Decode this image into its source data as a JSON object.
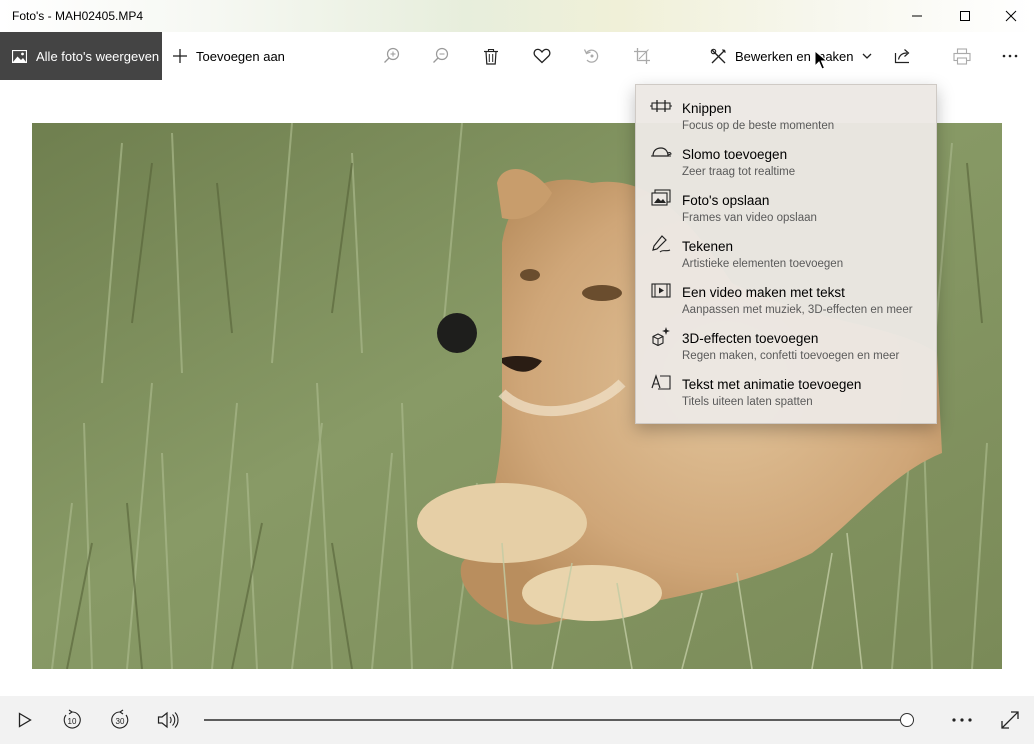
{
  "window": {
    "title": "Foto's - MAH02405.MP4",
    "controls": [
      "minimize-icon",
      "maximize-icon",
      "close-icon"
    ]
  },
  "toolbar": {
    "all_photos_label": "Alle foto's weergeven",
    "add_to_label": "Toevoegen aan",
    "edit_create_label": "Bewerken en maken",
    "icons": [
      "zoom-in-icon",
      "zoom-out-icon",
      "delete-icon",
      "favorite-icon",
      "rotate-icon",
      "crop-icon",
      "share-icon",
      "print-icon",
      "more-icon"
    ]
  },
  "edit_menu": {
    "items": [
      {
        "icon": "trim-icon",
        "title": "Knippen",
        "subtitle": "Focus op de beste momenten"
      },
      {
        "icon": "slomo-icon",
        "title": "Slomo toevoegen",
        "subtitle": "Zeer traag tot realtime"
      },
      {
        "icon": "save-frames-icon",
        "title": "Foto's opslaan",
        "subtitle": "Frames van video opslaan"
      },
      {
        "icon": "draw-icon",
        "title": "Tekenen",
        "subtitle": "Artistieke elementen toevoegen"
      },
      {
        "icon": "video-text-icon",
        "title": "Een video maken met tekst",
        "subtitle": "Aanpassen met muziek, 3D-effecten en meer"
      },
      {
        "icon": "3d-effects-icon",
        "title": "3D-effecten toevoegen",
        "subtitle": "Regen maken, confetti toevoegen en meer"
      },
      {
        "icon": "animated-text-icon",
        "title": "Tekst met animatie toevoegen",
        "subtitle": "Titels uiteen laten spatten"
      }
    ]
  },
  "player": {
    "skip_back_label": "10",
    "skip_forward_label": "30",
    "progress": 0.99,
    "icons": [
      "play-icon",
      "skip-back-icon",
      "skip-forward-icon",
      "volume-icon",
      "more-icon",
      "fullscreen-icon"
    ]
  },
  "colors": {
    "accent_dark": "#444444",
    "menu_bg": "#ece8e4",
    "controls_bg": "#f2f2f2"
  }
}
